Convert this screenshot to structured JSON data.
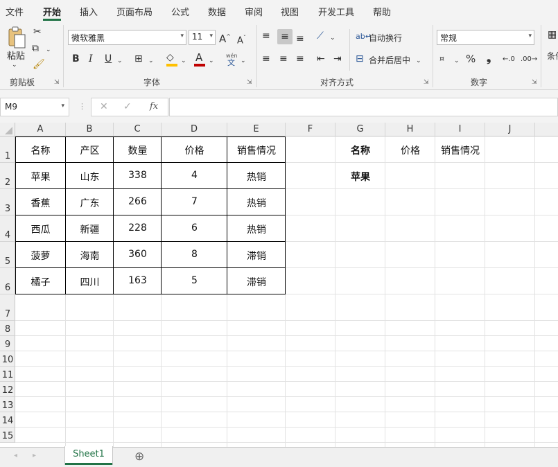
{
  "menu": {
    "items": [
      "文件",
      "开始",
      "插入",
      "页面布局",
      "公式",
      "数据",
      "审阅",
      "视图",
      "开发工具",
      "帮助"
    ],
    "active": "开始"
  },
  "ribbon": {
    "clipboard": {
      "paste_label": "粘贴",
      "group_label": "剪贴板"
    },
    "font": {
      "font_name": "微软雅黑",
      "font_size": "11",
      "group_label": "字体",
      "bold": "B",
      "italic": "I",
      "underline": "U",
      "pinyin": "wén"
    },
    "alignment": {
      "wrap_text": "自动换行",
      "merge_center": "合并后居中",
      "group_label": "对齐方式"
    },
    "number": {
      "format": "常规",
      "percent": "%",
      "comma": "❟",
      "group_label": "数字"
    },
    "styles": {
      "label": "条件"
    }
  },
  "formula_bar": {
    "name_box": "M9",
    "fx": "fx",
    "value": ""
  },
  "columns": [
    "A",
    "B",
    "C",
    "D",
    "E",
    "F",
    "G",
    "H",
    "I",
    "J"
  ],
  "rows": [
    "1",
    "2",
    "3",
    "4",
    "5",
    "6",
    "7",
    "8",
    "9",
    "10",
    "11",
    "12",
    "13",
    "14",
    "15"
  ],
  "table": {
    "headers": [
      "名称",
      "产区",
      "数量",
      "价格",
      "销售情况"
    ],
    "rows": [
      [
        "苹果",
        "山东",
        "338",
        "4",
        "热销"
      ],
      [
        "香蕉",
        "广东",
        "266",
        "7",
        "热销"
      ],
      [
        "西瓜",
        "新疆",
        "228",
        "6",
        "热销"
      ],
      [
        "菠萝",
        "海南",
        "360",
        "8",
        "滞销"
      ],
      [
        "橘子",
        "四川",
        "163",
        "5",
        "滞销"
      ]
    ]
  },
  "lookup": {
    "g1": "名称",
    "h1": "价格",
    "i1": "销售情况",
    "g2": "苹果"
  },
  "sheet_tabs": {
    "active": "Sheet1",
    "add": "⊕"
  },
  "colors": {
    "accent": "#217346",
    "font_color": "#c00000",
    "fill_color": "#ffc000"
  }
}
